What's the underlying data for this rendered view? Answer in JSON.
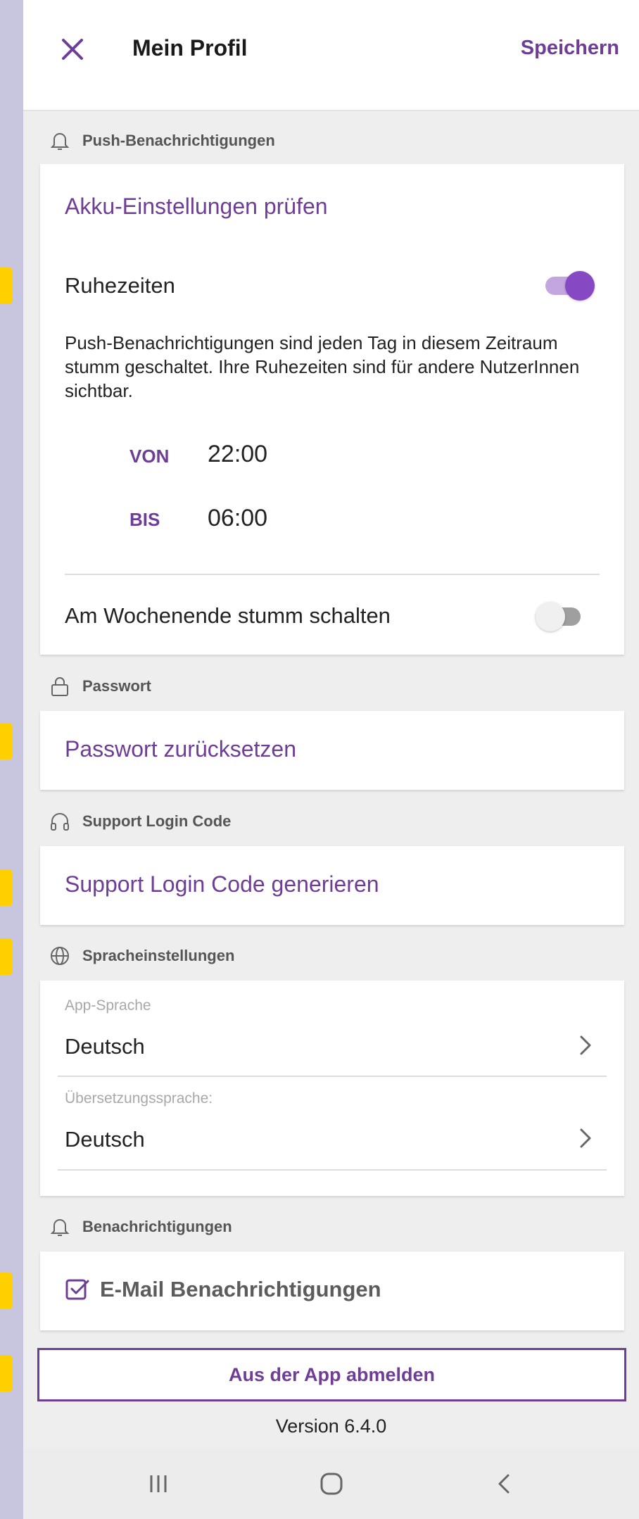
{
  "header": {
    "title": "Mein Profil",
    "save_label": "Speichern"
  },
  "sections": {
    "push": {
      "title": "Push-Benachrichtigungen"
    },
    "password": {
      "title": "Passwort"
    },
    "support": {
      "title": "Support Login Code"
    },
    "language": {
      "title": "Spracheinstellungen"
    },
    "notifications": {
      "title": "Benachrichtigungen"
    }
  },
  "push": {
    "battery_link": "Akku-Einstellungen prüfen",
    "quiet_hours_label": "Ruhezeiten",
    "quiet_hours_enabled": true,
    "description": "Push-Benachrichtigungen sind jeden Tag in diesem Zeitraum stumm geschaltet. Ihre Ruhezeiten sind für andere NutzerInnen sichtbar.",
    "from_label": "VON",
    "from_value": "22:00",
    "to_label": "BIS",
    "to_value": "06:00",
    "weekend_label": "Am Wochenende stumm schalten",
    "weekend_enabled": false
  },
  "password": {
    "reset_link": "Passwort zurücksetzen"
  },
  "support": {
    "generate_link": "Support Login Code generieren"
  },
  "language": {
    "app_language_label": "App-Sprache",
    "app_language_value": "Deutsch",
    "translation_language_label": "Übersetzungssprache:",
    "translation_language_value": "Deutsch"
  },
  "notifications": {
    "email_label": "E-Mail Benachrichtigungen",
    "email_checked": true
  },
  "footer": {
    "logout_label": "Aus der App abmelden",
    "version": "Version 6.4.0"
  },
  "colors": {
    "accent": "#6e3d96",
    "toggle_on": "#8748c4",
    "marker": "#ffd000"
  },
  "icons": [
    "close-icon",
    "bell-icon",
    "lock-icon",
    "headset-icon",
    "globe-icon",
    "chevron-right-icon",
    "checkbox-checked-icon",
    "recents-icon",
    "home-icon",
    "back-icon"
  ]
}
